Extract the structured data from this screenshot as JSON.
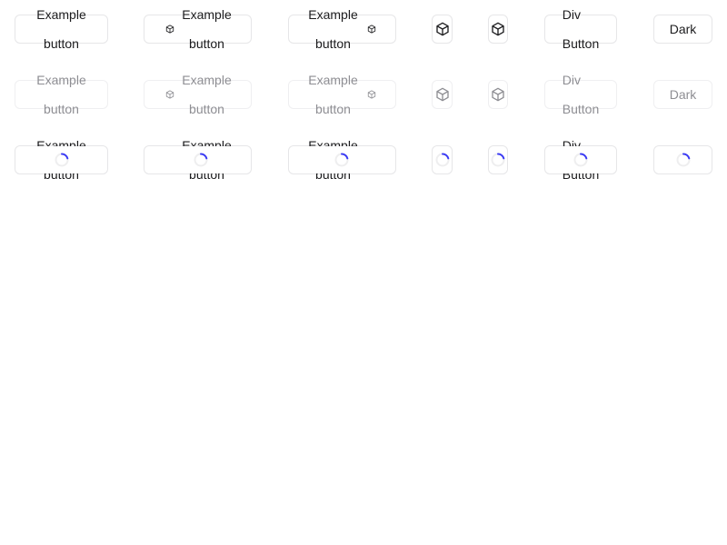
{
  "rows": [
    {
      "state": "default",
      "labels": {
        "example": "Example button",
        "div": "Div Button",
        "dark": "Dark"
      }
    },
    {
      "state": "disabled",
      "labels": {
        "example": "Example button",
        "div": "Div Button",
        "dark": "Dark"
      }
    },
    {
      "state": "loading",
      "labels": {
        "example": "Example button",
        "div": "Div Button",
        "dark": ""
      }
    }
  ],
  "icons": {
    "button_icon": "cube-icon",
    "loading": "spinner-icon"
  },
  "colors": {
    "text": "#1c1c1e",
    "disabled_text": "#8e8e93",
    "border": "#e6e6e8",
    "spinner": "#3a3af4",
    "spinner_track": "#eeeeef"
  }
}
